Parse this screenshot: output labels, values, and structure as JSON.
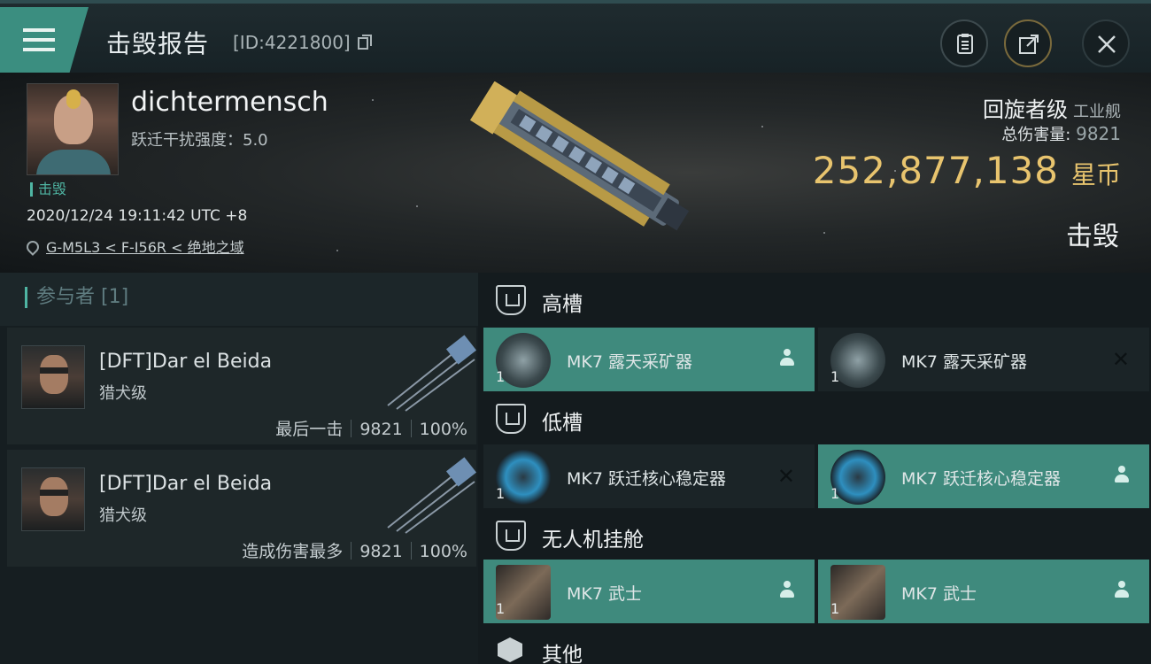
{
  "header": {
    "title": "击毁报告",
    "id_text": "[ID:4221800]",
    "colors": {
      "accent": "#3b8e80",
      "gold": "#e8c46e"
    },
    "icons": [
      "menu-icon",
      "copy-icon",
      "clipboard-icon",
      "share-icon",
      "close-icon"
    ]
  },
  "victim": {
    "name": "dichtermensch",
    "warp_label": "跃迁干扰强度：5.0",
    "status": "击毁",
    "timestamp": "2020/12/24 19:11:42 UTC +8",
    "location": "G-M5L3 < F-I56R < 绝地之域",
    "ship_name": "回旋者级",
    "ship_type": "工业舰",
    "damage_label": "总伤害量:",
    "damage_value": "9821",
    "isk_value": "252,877,138",
    "isk_unit": "星币",
    "result": "击毁"
  },
  "participants": {
    "label": "参与者 [1]",
    "items": [
      {
        "name": "[DFT]Dar el Beida",
        "ship": "猎犬级",
        "role": "最后一击",
        "damage": "9821",
        "percent": "100%"
      },
      {
        "name": "[DFT]Dar el Beida",
        "ship": "猎犬级",
        "role": "造成伤害最多",
        "damage": "9821",
        "percent": "100%"
      }
    ]
  },
  "fitting": {
    "high_slot": {
      "title": "高槽",
      "modules": [
        {
          "name": "MK7 露天采矿器",
          "qty": "1",
          "state": "destroyed"
        },
        {
          "name": "MK7 露天采矿器",
          "qty": "1",
          "state": "dropped"
        }
      ]
    },
    "low_slot": {
      "title": "低槽",
      "modules": [
        {
          "name": "MK7 跃迁核心稳定器",
          "qty": "1",
          "state": "dropped"
        },
        {
          "name": "MK7 跃迁核心稳定器",
          "qty": "1",
          "state": "destroyed"
        }
      ]
    },
    "drone_bay": {
      "title": "无人机挂舱",
      "modules": [
        {
          "name": "MK7 武士",
          "qty": "1",
          "state": "destroyed"
        },
        {
          "name": "MK7 武士",
          "qty": "1",
          "state": "destroyed"
        }
      ]
    },
    "other": {
      "title": "其他"
    }
  }
}
